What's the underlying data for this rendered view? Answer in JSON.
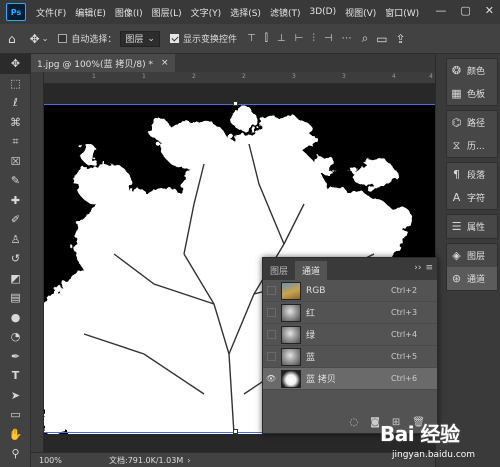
{
  "app": {
    "logo": "Ps"
  },
  "menu": [
    "文件(F)",
    "编辑(E)",
    "图像(I)",
    "图层(L)",
    "文字(Y)",
    "选择(S)",
    "滤镜(T)",
    "3D(D)",
    "视图(V)",
    "窗口(W)"
  ],
  "window_controls": {
    "minimize": "—",
    "restore": "▢",
    "close": "✕"
  },
  "options": {
    "auto_select_label": "自动选择：",
    "auto_select_checked": false,
    "auto_select_value": "图层",
    "show_transform_label": "显示变换控件",
    "show_transform_checked": true
  },
  "document": {
    "tab_title": "1.jpg @ 100%(蓝 拷贝/8) *",
    "zoom": "100%",
    "doc_info": "文档:791.0K/1.03M"
  },
  "rulers": {
    "top": [
      "1",
      "1",
      "2",
      "2",
      "3",
      "3",
      "4",
      "4"
    ]
  },
  "dock": {
    "group1": [
      {
        "icon": "palette-icon",
        "label": "颜色"
      },
      {
        "icon": "swatches-icon",
        "label": "色板"
      }
    ],
    "group2": [
      {
        "icon": "paths-icon",
        "label": "路径"
      },
      {
        "icon": "history-icon",
        "label": "历..."
      }
    ],
    "group3": [
      {
        "icon": "paragraph-icon",
        "label": "段落"
      },
      {
        "icon": "character-icon",
        "label": "字符"
      }
    ],
    "group4": [
      {
        "icon": "properties-icon",
        "label": "属性"
      }
    ],
    "group5": [
      {
        "icon": "layers-icon",
        "label": "图层"
      },
      {
        "icon": "channels-icon",
        "label": "通道"
      }
    ]
  },
  "channels_panel": {
    "tabs": [
      "图层",
      "通道"
    ],
    "active_tab": 1,
    "rows": [
      {
        "name": "RGB",
        "shortcut": "Ctrl+2",
        "visible": false,
        "thumb": "rgb"
      },
      {
        "name": "红",
        "shortcut": "Ctrl+3",
        "visible": false,
        "thumb": "gray"
      },
      {
        "name": "绿",
        "shortcut": "Ctrl+4",
        "visible": false,
        "thumb": "gray"
      },
      {
        "name": "蓝",
        "shortcut": "Ctrl+5",
        "visible": false,
        "thumb": "gray"
      },
      {
        "name": "蓝 拷贝",
        "shortcut": "Ctrl+6",
        "visible": true,
        "thumb": "bw",
        "selected": true
      }
    ]
  },
  "watermark": {
    "main": "Bai 经验",
    "sub": "jingyan.baidu.com"
  }
}
